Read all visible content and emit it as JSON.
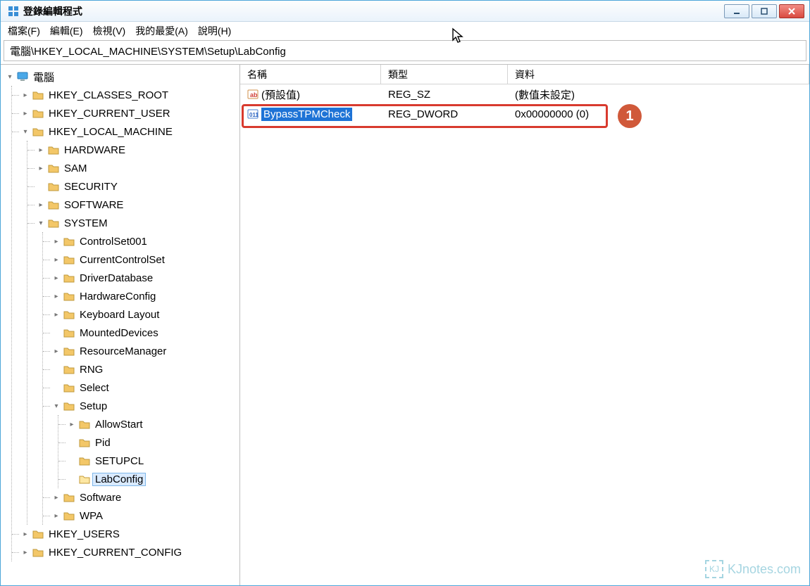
{
  "window": {
    "title": "登錄編輯程式"
  },
  "menu": {
    "file": "檔案(F)",
    "edit": "編輯(E)",
    "view": "檢視(V)",
    "favorites": "我的最愛(A)",
    "help": "說明(H)"
  },
  "address": {
    "path": "電腦\\HKEY_LOCAL_MACHINE\\SYSTEM\\Setup\\LabConfig"
  },
  "tree": {
    "root": "電腦",
    "hkcr": "HKEY_CLASSES_ROOT",
    "hkcu": "HKEY_CURRENT_USER",
    "hklm": "HKEY_LOCAL_MACHINE",
    "hardware": "HARDWARE",
    "sam": "SAM",
    "security": "SECURITY",
    "software": "SOFTWARE",
    "system": "SYSTEM",
    "cs001": "ControlSet001",
    "ccs": "CurrentControlSet",
    "drvdb": "DriverDatabase",
    "hwcfg": "HardwareConfig",
    "keylay": "Keyboard Layout",
    "mounted": "MountedDevices",
    "resmgr": "ResourceManager",
    "rng": "RNG",
    "select": "Select",
    "setup": "Setup",
    "allowstart": "AllowStart",
    "pid": "Pid",
    "setupcl": "SETUPCL",
    "labconfig": "LabConfig",
    "softwaren": "Software",
    "wpa": "WPA",
    "hku": "HKEY_USERS",
    "hkcc": "HKEY_CURRENT_CONFIG"
  },
  "list": {
    "header": {
      "name": "名稱",
      "type": "類型",
      "data": "資料"
    },
    "rows": [
      {
        "name": "(預設值)",
        "type": "REG_SZ",
        "data": "(數值未設定)",
        "icon": "string"
      },
      {
        "name": "BypassTPMCheck",
        "type": "REG_DWORD",
        "data": "0x00000000 (0)",
        "icon": "binary"
      }
    ]
  },
  "annotation": {
    "step1": "1"
  },
  "watermark": {
    "text": "KJnotes.com",
    "badge": "KJ"
  }
}
